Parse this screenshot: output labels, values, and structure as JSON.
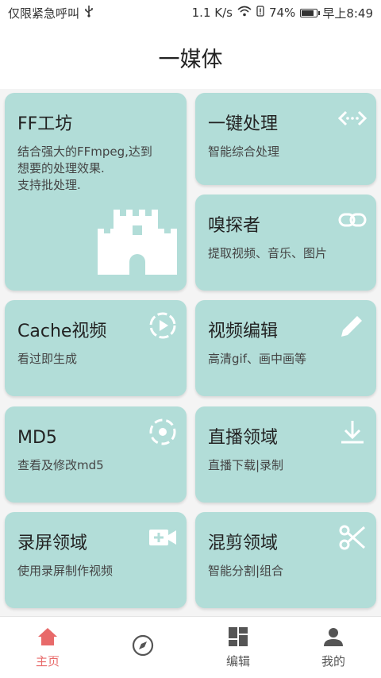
{
  "status": {
    "carrier": "仅限紧急呼叫",
    "speed": "1.1 K/s",
    "battery": "74%",
    "battery_level": 0.74,
    "time": "早上8:49"
  },
  "header": {
    "title": "一媒体"
  },
  "cards": [
    {
      "title": "FF工坊",
      "desc": "结合强大的FFmpeg,达到\n想要的处理效果.\n支持批处理.",
      "icon": "castle-icon"
    },
    {
      "title": "一键处理",
      "desc": "智能综合处理",
      "icon": "code-icon"
    },
    {
      "title": "嗅探者",
      "desc": "提取视频、音乐、图片",
      "icon": "link-icon"
    },
    {
      "title": "Cache视频",
      "desc": "看过即生成",
      "icon": "play-circle-icon"
    },
    {
      "title": "视频编辑",
      "desc": "高清gif、画中画等",
      "icon": "pencil-icon"
    },
    {
      "title": "MD5",
      "desc": "查看及修改md5",
      "icon": "target-icon"
    },
    {
      "title": "直播领域",
      "desc": "直播下载|录制",
      "icon": "download-icon"
    },
    {
      "title": "录屏领域",
      "desc": "使用录屏制作视频",
      "icon": "video-add-icon"
    },
    {
      "title": "混剪领域",
      "desc": "智能分割|组合",
      "icon": "scissors-icon"
    }
  ],
  "tabs": [
    {
      "label": "主页",
      "icon": "home-icon",
      "active": true
    },
    {
      "label": "",
      "icon": "compass-icon",
      "active": false
    },
    {
      "label": "编辑",
      "icon": "dashboard-icon",
      "active": false
    },
    {
      "label": "我的",
      "icon": "person-icon",
      "active": false
    }
  ],
  "colors": {
    "card": "#b2ddd8",
    "accent": "#e86a6a",
    "icon": "#ffffff"
  }
}
